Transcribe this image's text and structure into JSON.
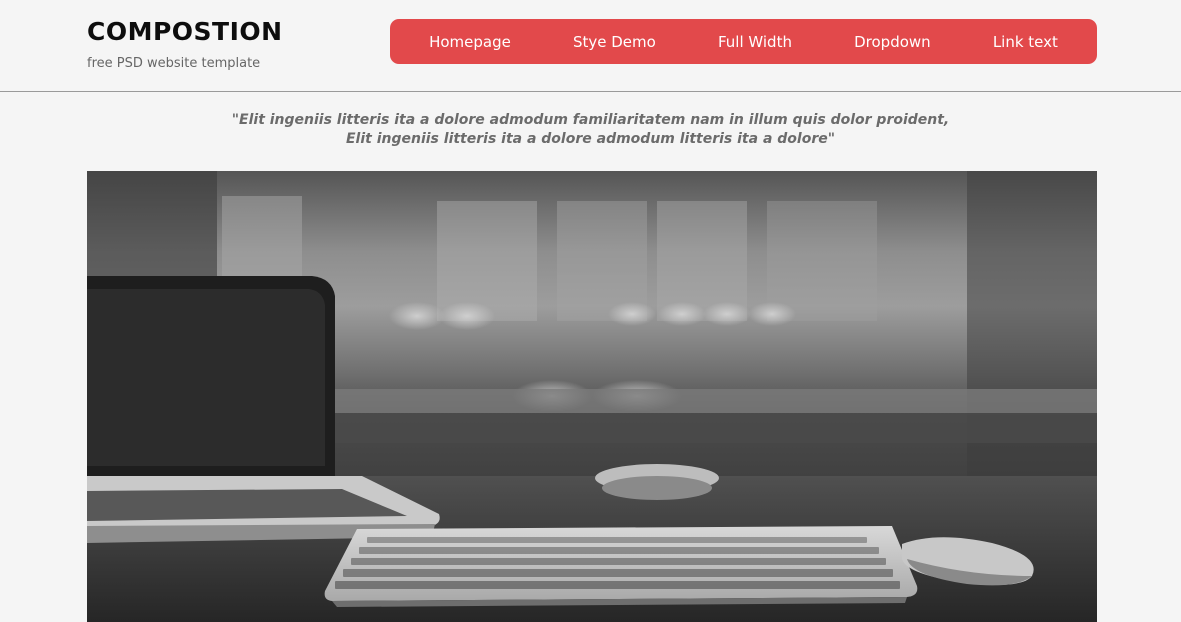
{
  "header": {
    "title": "COMPOSTION",
    "tagline": "free PSD website template"
  },
  "nav": {
    "items": [
      "Homepage",
      "Stye Demo",
      "Full Width",
      "Dropdown",
      "Link text"
    ],
    "background_color": "#e2494b"
  },
  "quote": {
    "line1": "\"Elit ingeniis litteris ita a dolore admodum familiaritatem nam in illum quis dolor proident,",
    "line2": "Elit ingeniis litteris ita a dolore admodum litteris ita a dolore\""
  },
  "hero": {
    "image_subject": "desk-with-keyboard-laptop-mouse",
    "tone": "grayscale"
  }
}
